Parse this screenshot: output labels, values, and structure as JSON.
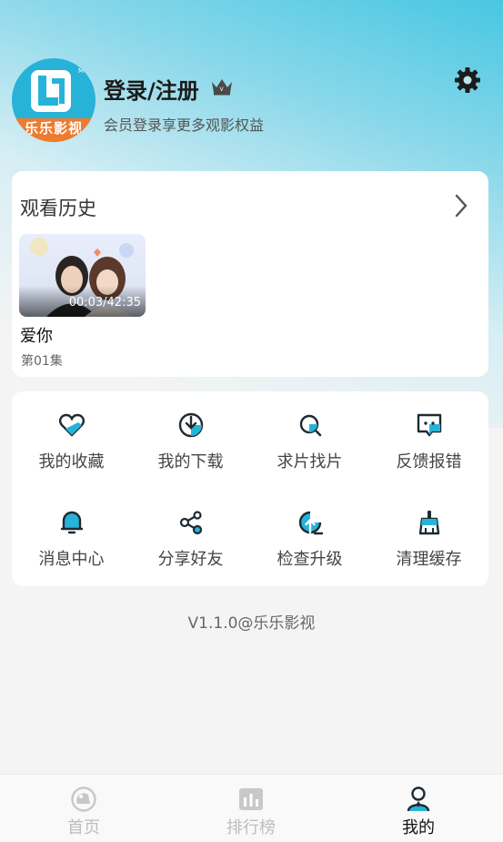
{
  "profile": {
    "avatar_caption": "乐乐影视",
    "title": "登录/注册",
    "subtitle": "会员登录享更多观影权益"
  },
  "history": {
    "title": "观看历史",
    "items": [
      {
        "title": "爱你",
        "episode": "第01集",
        "progress": "00:03/42:35"
      }
    ]
  },
  "menu": {
    "items": [
      {
        "label": "我的收藏",
        "icon": "heart-icon"
      },
      {
        "label": "我的下载",
        "icon": "download-icon"
      },
      {
        "label": "求片找片",
        "icon": "search-icon"
      },
      {
        "label": "反馈报错",
        "icon": "feedback-icon"
      },
      {
        "label": "消息中心",
        "icon": "bell-icon"
      },
      {
        "label": "分享好友",
        "icon": "share-icon"
      },
      {
        "label": "检查升级",
        "icon": "upgrade-icon"
      },
      {
        "label": "清理缓存",
        "icon": "broom-icon"
      }
    ]
  },
  "version": "V1.1.0@乐乐影视",
  "tabbar": {
    "items": [
      {
        "label": "首页",
        "icon": "home-icon",
        "active": false
      },
      {
        "label": "排行榜",
        "icon": "ranking-icon",
        "active": false
      },
      {
        "label": "我的",
        "icon": "profile-icon",
        "active": true
      }
    ]
  },
  "colors": {
    "accent": "#27b3d8",
    "brand_orange": "#f07a2e",
    "icon_dark": "#1e2a33"
  }
}
